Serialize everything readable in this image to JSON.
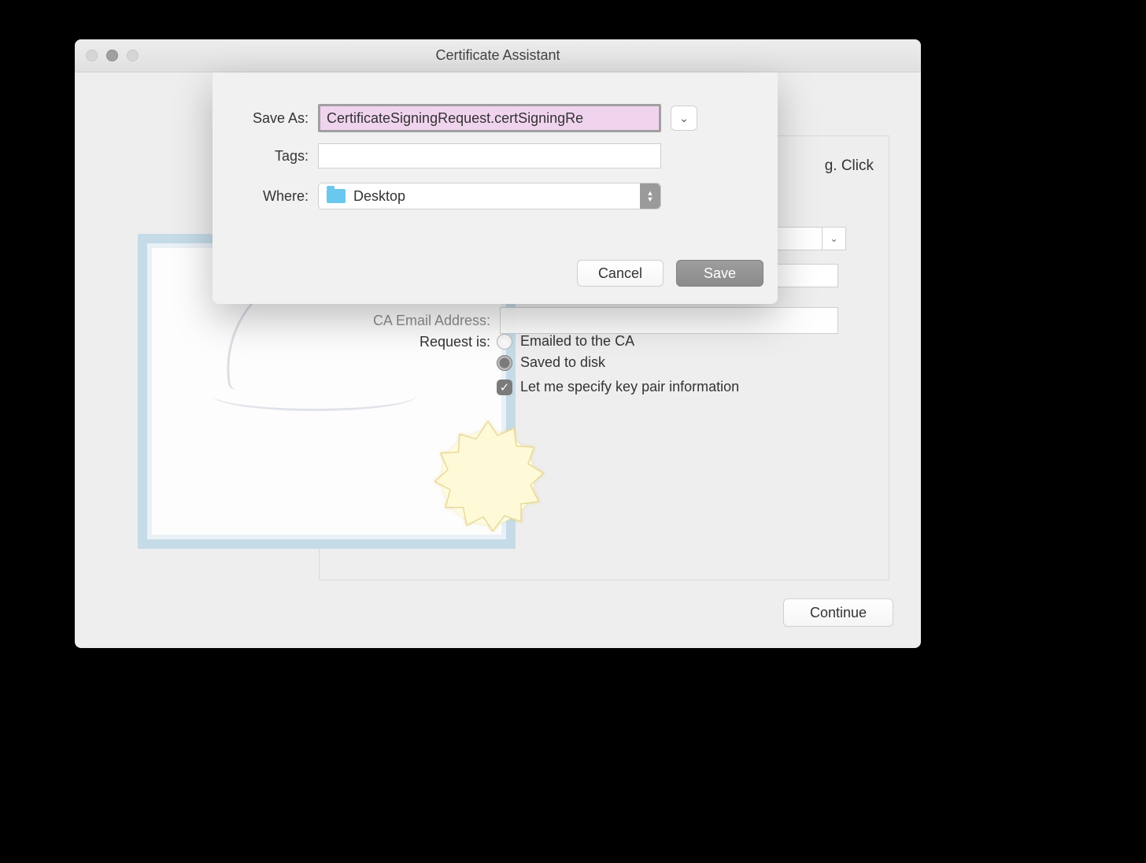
{
  "window": {
    "title": "Certificate Assistant"
  },
  "instruction_fragment": "g. Click",
  "form": {
    "ca_email_label": "CA Email Address:",
    "request_label": "Request is:",
    "radio_emailed": "Emailed to the CA",
    "radio_saved": "Saved to disk",
    "checkbox_keypair": "Let me specify key pair information"
  },
  "continue_label": "Continue",
  "sheet": {
    "save_as_label": "Save As:",
    "save_as_value": "CertificateSigningRequest.certSigningRe",
    "tags_label": "Tags:",
    "tags_value": "",
    "where_label": "Where:",
    "where_value": "Desktop",
    "cancel": "Cancel",
    "save": "Save"
  }
}
